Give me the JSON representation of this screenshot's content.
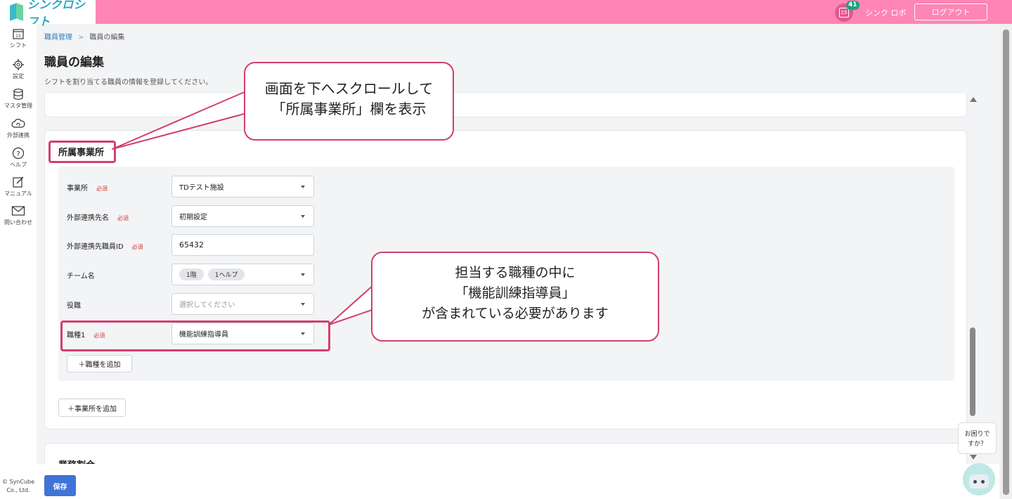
{
  "header": {
    "logo_text": "シンクロシフト",
    "notification_count": "41",
    "calendar_day": "15",
    "user_name": "シンク ロボ",
    "logout_label": "ログアウト"
  },
  "sidebar": {
    "items": [
      {
        "label": "シフト",
        "icon": "calendar-icon",
        "day": "15"
      },
      {
        "label": "設定",
        "icon": "gear-icon"
      },
      {
        "label": "マスタ管理",
        "icon": "database-icon"
      },
      {
        "label": "外部連携",
        "icon": "cloud-icon"
      },
      {
        "label": "ヘルプ",
        "icon": "help-icon"
      },
      {
        "label": "マニュアル",
        "icon": "edit-icon"
      },
      {
        "label": "問い合わせ",
        "icon": "mail-icon"
      }
    ],
    "copyright_line1": "© SynCube",
    "copyright_line2": "Co., Ltd."
  },
  "breadcrumb": {
    "parent": "職員管理",
    "separator": ">",
    "current": "職員の編集"
  },
  "page": {
    "title": "職員の編集",
    "description": "シフトを割り当てる職員の情報を登録してください。"
  },
  "affiliation": {
    "section_title": "所属事業所",
    "required_label": "必須",
    "fields": {
      "office": {
        "label": "事業所",
        "value": "TDテスト施設"
      },
      "external_name": {
        "label": "外部連携先名",
        "value": "初期設定"
      },
      "external_staff_id": {
        "label": "外部連携先職員ID",
        "value": "65432"
      },
      "team": {
        "label": "チーム名",
        "chips": [
          "1階",
          "1ヘルプ"
        ]
      },
      "position": {
        "label": "役職",
        "placeholder": "選択してください"
      },
      "job_type": {
        "label": "職種1",
        "value": "機能訓練指導員"
      }
    },
    "add_job_label": "＋職種を追加",
    "add_office_label": "＋事業所を追加"
  },
  "next_section": {
    "title": "業務割合"
  },
  "footer": {
    "save_label": "保存"
  },
  "help_widget": {
    "line1": "お困りで",
    "line2": "すか？"
  },
  "annotations": {
    "callout1": {
      "line1": "画面を下へスクロールして",
      "line2": "「所属事業所」欄を表示"
    },
    "callout2": {
      "line1": "担当する職種の中に",
      "line2": "「機能訓練指導員」",
      "line3": "が含まれている必要があります"
    }
  },
  "colors": {
    "header": "#ff85b4",
    "accent": "#d23f6e",
    "primary_button": "#3f73d6",
    "required": "#d03b3b"
  }
}
